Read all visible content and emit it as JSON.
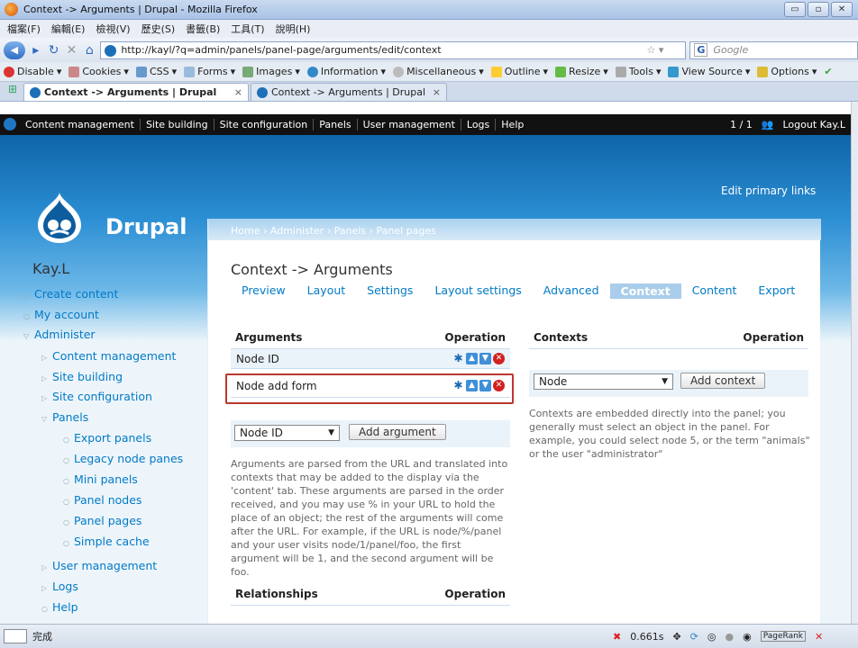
{
  "window": {
    "title": "Context -> Arguments | Drupal - Mozilla Firefox",
    "buttons": [
      "▭",
      "▫",
      "✕"
    ]
  },
  "menubar": [
    "檔案(F)",
    "編輯(E)",
    "檢視(V)",
    "歷史(S)",
    "書籤(B)",
    "工具(T)",
    "說明(H)"
  ],
  "nav": {
    "url": "http://kayl/?q=admin/panels/panel-page/arguments/edit/context",
    "search_placeholder": "Google",
    "search_engine": "G"
  },
  "toolbar": [
    "Disable",
    "Cookies",
    "CSS",
    "Forms",
    "Images",
    "Information",
    "Miscellaneous",
    "Outline",
    "Resize",
    "Tools",
    "View Source",
    "Options"
  ],
  "tabs": [
    {
      "label": "Context -> Arguments | Drupal",
      "close": "×"
    },
    {
      "label": "Context -> Arguments | Drupal",
      "close": "×"
    }
  ],
  "adminbar": {
    "items": [
      "Content management",
      "Site building",
      "Site configuration",
      "Panels",
      "User management",
      "Logs",
      "Help"
    ],
    "count": "1 / 1",
    "logout": "Logout Kay.L"
  },
  "header": {
    "site_name": "Drupal",
    "edit_links": "Edit primary links"
  },
  "sidebar": {
    "username": "Kay.L",
    "items": [
      "Create content",
      "My account",
      "Administer",
      "Content management",
      "Site building",
      "Site configuration",
      "Panels",
      "Export panels",
      "Legacy node panes",
      "Mini panels",
      "Panel nodes",
      "Panel pages",
      "Simple cache",
      "User management",
      "Logs",
      "Help"
    ]
  },
  "content": {
    "breadcrumb": "Home › Administer › Panels › Panel pages",
    "title": "Context -> Arguments",
    "tabs": [
      "Preview",
      "Layout",
      "Settings",
      "Layout settings",
      "Advanced",
      "Context",
      "Content",
      "Export"
    ],
    "arguments": {
      "header": "Arguments",
      "op_header": "Operation",
      "rows": [
        "Node ID",
        "Node add form"
      ],
      "select_value": "Node ID",
      "add_button": "Add argument",
      "description": "Arguments are parsed from the URL and translated into contexts that may be added to the display via the 'content' tab. These arguments are parsed in the order received, and you may use % in your URL to hold the place of an object; the rest of the arguments will come after the URL. For example, if the URL is node/%/panel and your user visits node/1/panel/foo, the first argument will be 1, and the second argument will be foo."
    },
    "contexts": {
      "header": "Contexts",
      "op_header": "Operation",
      "select_value": "Node",
      "add_button": "Add context",
      "description": "Contexts are embedded directly into the panel; you generally must select an object in the panel. For example, you could select node 5, or the term \"animals\" or the user \"administrator\""
    },
    "relationships": {
      "header": "Relationships",
      "op_header": "Operation"
    }
  },
  "status": {
    "text": "完成",
    "timing": "0.661s",
    "pagerank": "PageRank"
  }
}
